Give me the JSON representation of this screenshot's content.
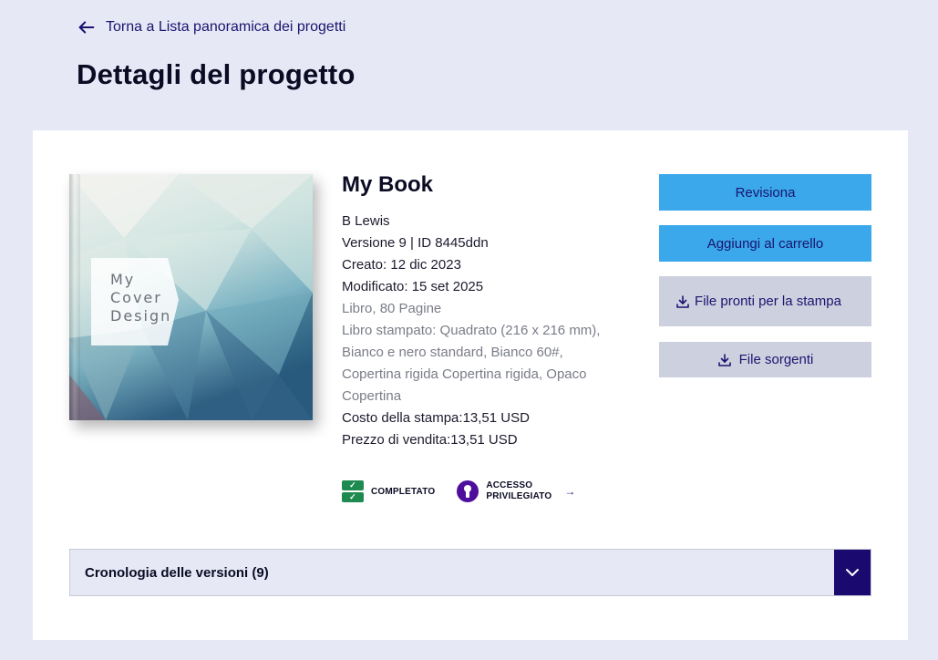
{
  "nav": {
    "back_label": "Torna a Lista panoramica dei progetti"
  },
  "page": {
    "title": "Dettagli del progetto"
  },
  "cover": {
    "text_line1": "My",
    "text_line2": "Cover",
    "text_line3": "Design"
  },
  "book": {
    "title": "My Book",
    "author": "B Lewis",
    "version": "Versione 9 | ID 8445ddn",
    "created": "Creato: 12 dic 2023",
    "modified": "Modificato: 15 set 2025",
    "format": "Libro, 80 Pagine",
    "specs_line1": "Libro stampato: Quadrato (216 x 216 mm),",
    "specs_line2": "Bianco e nero standard, Bianco 60#,",
    "specs_line3": "Copertina rigida Copertina rigida, Opaco",
    "specs_line4": "Copertina",
    "print_cost": "Costo della stampa:13,51 USD",
    "sale_price": "Prezzo di vendita:13,51 USD"
  },
  "status": {
    "completed_label": "COMPLETATO",
    "privileged_line1": "ACCESSO",
    "privileged_line2": "PRIVILEGIATO"
  },
  "actions": {
    "review_label": "Revisiona",
    "add_to_cart_label": "Aggiungi al carrello",
    "print_files_label": "File pronti per la stampa",
    "source_files_label": "File sorgenti"
  },
  "history": {
    "label": "Cronologia delle versioni (9)"
  },
  "colors": {
    "primary_button": "#3aa8ea",
    "secondary_button": "#cdd0de",
    "accent_dark": "#1a0a6f",
    "completed_green": "#1e8a4f",
    "privileged_purple": "#4d0f9c",
    "page_background": "#e6e9f5"
  },
  "icons": {
    "back": "arrow-left-icon",
    "download": "download-icon",
    "completed": "checklist-icon",
    "privileged": "keyhole-icon",
    "forward": "arrow-right-icon",
    "expand": "chevron-down-icon"
  }
}
